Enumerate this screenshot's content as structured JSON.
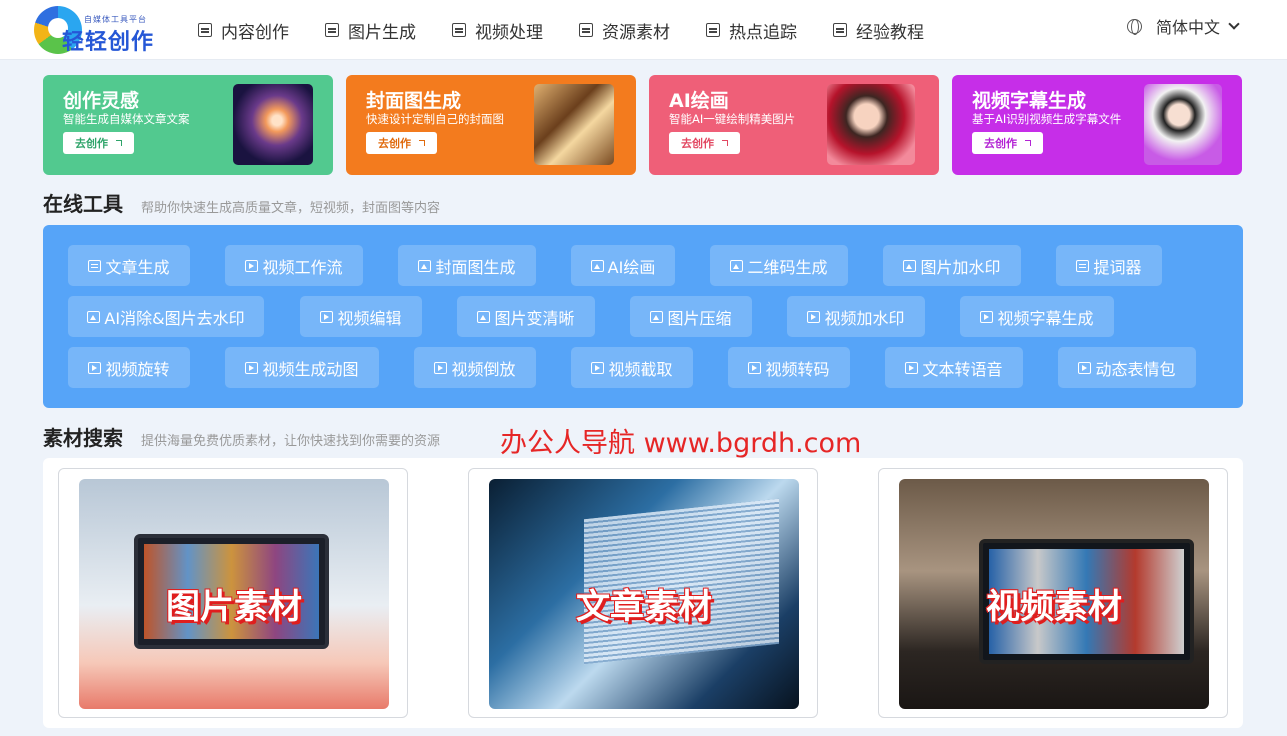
{
  "header": {
    "logo": {
      "subtitle": "自媒体工具平台",
      "name": "轻轻创作"
    },
    "nav": [
      {
        "label": "内容创作",
        "icon": "document-edit-icon"
      },
      {
        "label": "图片生成",
        "icon": "image-icon"
      },
      {
        "label": "视频处理",
        "icon": "video-icon"
      },
      {
        "label": "资源素材",
        "icon": "inbox-icon"
      },
      {
        "label": "热点追踪",
        "icon": "news-icon"
      },
      {
        "label": "经验教程",
        "icon": "book-icon"
      }
    ],
    "language": {
      "label": "简体中文",
      "icon": "globe-icon"
    }
  },
  "feature_cards": [
    {
      "title": "创作灵感",
      "desc": "智能生成自媒体文章文案",
      "button": "去创作",
      "color": "#52c98f"
    },
    {
      "title": "封面图生成",
      "desc": "快速设计定制自己的封面图",
      "button": "去创作",
      "color": "#f37b1e"
    },
    {
      "title": "AI绘画",
      "desc": "智能AI一键绘制精美图片",
      "button": "去创作",
      "color": "#ef5f78"
    },
    {
      "title": "视频字幕生成",
      "desc": "基于AI识别视频生成字幕文件",
      "button": "去创作",
      "color": "#c62ee8"
    }
  ],
  "tools_section": {
    "title": "在线工具",
    "subtitle": "帮助你快速生成高质量文章，短视频，封面图等内容",
    "panel_color": "#56a4f8",
    "rows": [
      [
        {
          "label": "文章生成",
          "icon": "doc"
        },
        {
          "label": "视频工作流",
          "icon": "video"
        },
        {
          "label": "封面图生成",
          "icon": "image"
        },
        {
          "label": "AI绘画",
          "icon": "image"
        },
        {
          "label": "二维码生成",
          "icon": "image"
        },
        {
          "label": "图片加水印",
          "icon": "image"
        },
        {
          "label": "提词器",
          "icon": "doc"
        }
      ],
      [
        {
          "label": "AI消除&图片去水印",
          "icon": "image"
        },
        {
          "label": "视频编辑",
          "icon": "video"
        },
        {
          "label": "图片变清晰",
          "icon": "image"
        },
        {
          "label": "图片压缩",
          "icon": "image"
        },
        {
          "label": "视频加水印",
          "icon": "video"
        },
        {
          "label": "视频字幕生成",
          "icon": "video"
        }
      ],
      [
        {
          "label": "视频旋转",
          "icon": "video"
        },
        {
          "label": "视频生成动图",
          "icon": "video"
        },
        {
          "label": "视频倒放",
          "icon": "video"
        },
        {
          "label": "视频截取",
          "icon": "video"
        },
        {
          "label": "视频转码",
          "icon": "video"
        },
        {
          "label": "文本转语音",
          "icon": "video"
        },
        {
          "label": "动态表情包",
          "icon": "video"
        }
      ]
    ]
  },
  "watermark": "办公人导航 www.bgrdh.com",
  "materials_section": {
    "title": "素材搜索",
    "subtitle": "提供海量免费优质素材，让你快速找到你需要的资源",
    "items": [
      {
        "label": "图片素材"
      },
      {
        "label": "文章素材"
      },
      {
        "label": "视频素材"
      }
    ]
  }
}
